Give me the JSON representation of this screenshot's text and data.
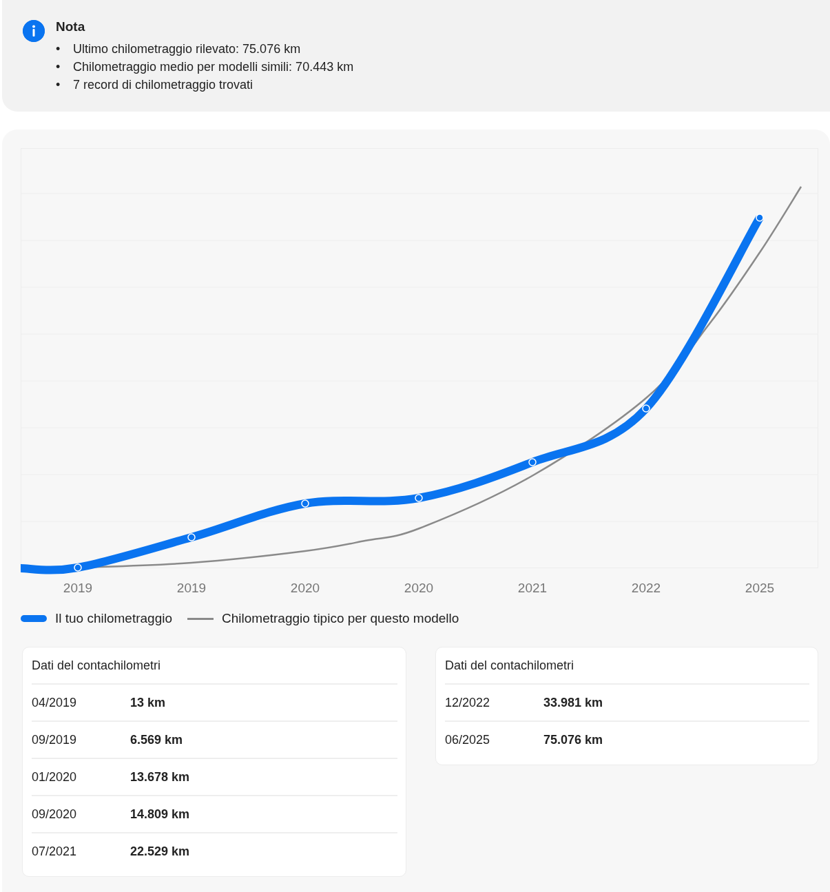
{
  "note": {
    "title": "Nota",
    "items": [
      {
        "bullet": "•",
        "text": "Ultimo chilometraggio rilevato: 75.076 km"
      },
      {
        "bullet": "•",
        "text": "Chilometraggio medio per modelli simili: 70.443 km"
      },
      {
        "bullet": "•",
        "text": "7 record di chilometraggio trovati"
      }
    ]
  },
  "chart": {
    "x_labels": [
      "2019",
      "2019",
      "2020",
      "2020",
      "2021",
      "2022",
      "2025"
    ],
    "legend": [
      {
        "kind": "thick",
        "label": "Il tuo chilometraggio",
        "color": "#0a74f0"
      },
      {
        "kind": "thin",
        "label": "Chilometraggio tipico per questo modello",
        "color": "#8a8a8a"
      }
    ]
  },
  "tables": [
    {
      "title": "Dati del contachilometri",
      "rows": [
        {
          "date": "04/2019",
          "km": "13 km"
        },
        {
          "date": "09/2019",
          "km": "6.569 km"
        },
        {
          "date": "01/2020",
          "km": "13.678 km"
        },
        {
          "date": "09/2020",
          "km": "14.809 km"
        },
        {
          "date": "07/2021",
          "km": "22.529 km"
        }
      ]
    },
    {
      "title": "Dati del contachilometri",
      "rows": [
        {
          "date": "12/2022",
          "km": "33.981 km"
        },
        {
          "date": "06/2025",
          "km": "75.076 km"
        }
      ]
    }
  ]
}
